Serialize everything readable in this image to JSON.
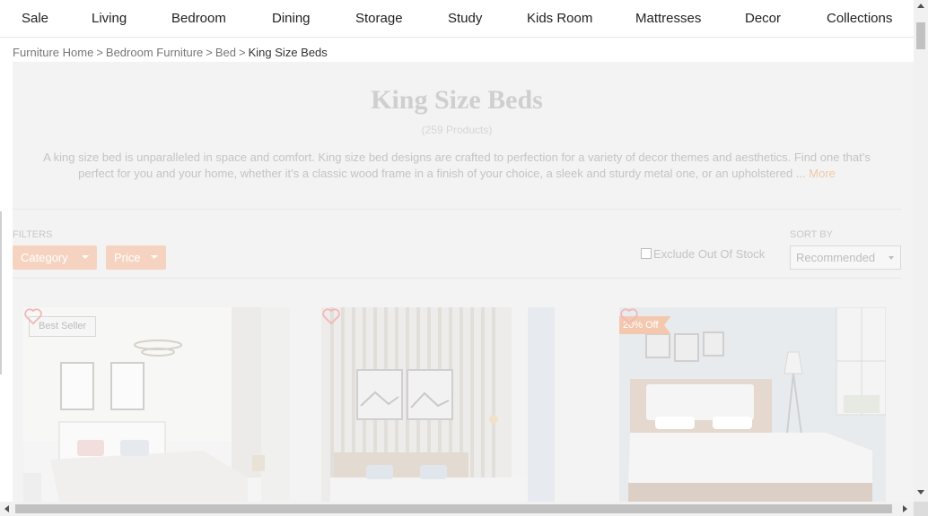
{
  "nav": {
    "items": [
      "Sale",
      "Living",
      "Bedroom",
      "Dining",
      "Storage",
      "Study",
      "Kids Room",
      "Mattresses",
      "Decor",
      "Collections"
    ]
  },
  "breadcrumb": {
    "items": [
      "Furniture Home",
      "Bedroom Furniture",
      "Bed"
    ],
    "separator": ">",
    "current": "King Size Beds"
  },
  "hero": {
    "title": "King Size Beds",
    "count": "(259 Products)",
    "description": "A king size bed is unparalleled in space and comfort. King size bed designs are crafted to perfection for a variety of decor themes and aesthetics. Find one that’s perfect for you and your home, whether it’s a classic wood frame in a finish of your choice, a sleek and sturdy metal one, or an upholstered ...",
    "more_label": "More"
  },
  "filters": {
    "label": "FILTERS",
    "buttons": [
      "Category",
      "Price"
    ],
    "exclude_out_of_stock": {
      "label": "Exclude Out Of Stock",
      "checked": false
    }
  },
  "sort": {
    "label": "SORT BY",
    "selected": "Recommended"
  },
  "products": [
    {
      "badge": "Best Seller",
      "badge_type": "seller",
      "wishlist_icon": "heart-icon"
    },
    {
      "badge": "",
      "badge_type": "none",
      "wishlist_icon": "heart-icon"
    },
    {
      "badge": "20% Off",
      "badge_type": "discount",
      "wishlist_icon": "heart-icon"
    }
  ],
  "colors": {
    "accent": "#f6d3c0",
    "overlay": "#f3f3f3",
    "heart": "#f2b8b8"
  }
}
